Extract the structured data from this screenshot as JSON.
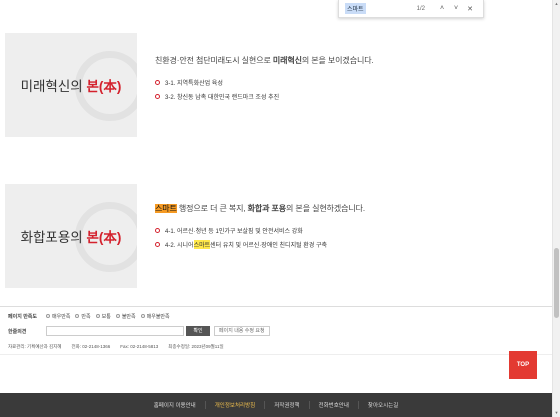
{
  "find_bar": {
    "query": "스마트",
    "count": "1/2",
    "prev_label": "˄",
    "next_label": "˅",
    "close_label": "✕"
  },
  "pillars": [
    {
      "title_prefix": "미래혁신의",
      "title_highlight": "본(本)",
      "lead_part1": "친환경·안전 첨단미래도시 실현으로 ",
      "lead_bold": "미래혁신",
      "lead_part2": "의 본을 보이겠습니다.",
      "items": [
        {
          "text": "3-1. 지역특화산업 육성"
        },
        {
          "text": "3-2. 창신동 남촉 대한민국 랜드마크 조성 추진"
        }
      ]
    },
    {
      "title_prefix": "화합포용의",
      "title_highlight": "본(本)",
      "lead_mark": "스마트",
      "lead_part1": " 행정으로 더 큰 복지, ",
      "lead_bold": "화합과 포용",
      "lead_part2": "의 본을 실현하겠습니다.",
      "items": [
        {
          "text": "4-1. 어르신·청년 등 1인가구 보살핌 및 안전서비스 강화"
        },
        {
          "text_before": "4-2. 시니어 ",
          "mark": "스마트",
          "text_after": "센터 유치 및 어르신·장애인 친디지털 환경 구축"
        }
      ]
    }
  ],
  "feedback": {
    "label": "페이지 만족도",
    "options": [
      "매우만족",
      "만족",
      "보통",
      "불만족",
      "매우불만족"
    ],
    "opinion_label": "한줄의견",
    "submit_label": "확인",
    "view_label": "페이지 내용 수정 요청"
  },
  "contact": {
    "dept": "자료관리: 기획예산과 김지혜",
    "phone": "전화: 02-2148-1366",
    "fax": "Fax: 02-2148-5813",
    "updated": "최종수정일: 2023년09월11일"
  },
  "top_button_label": "TOP",
  "footer": {
    "items": [
      "홈페이지 이용안내",
      "개인정보처리방침",
      "저작권정책",
      "전화번호안내",
      "찾아오시는길"
    ],
    "highlight_color": "#f2c14e"
  },
  "colors": {
    "accent_red": "#d4212d",
    "search_mark": "#ffe84a",
    "search_current": "#f59a23",
    "top_button": "#e33a32"
  }
}
